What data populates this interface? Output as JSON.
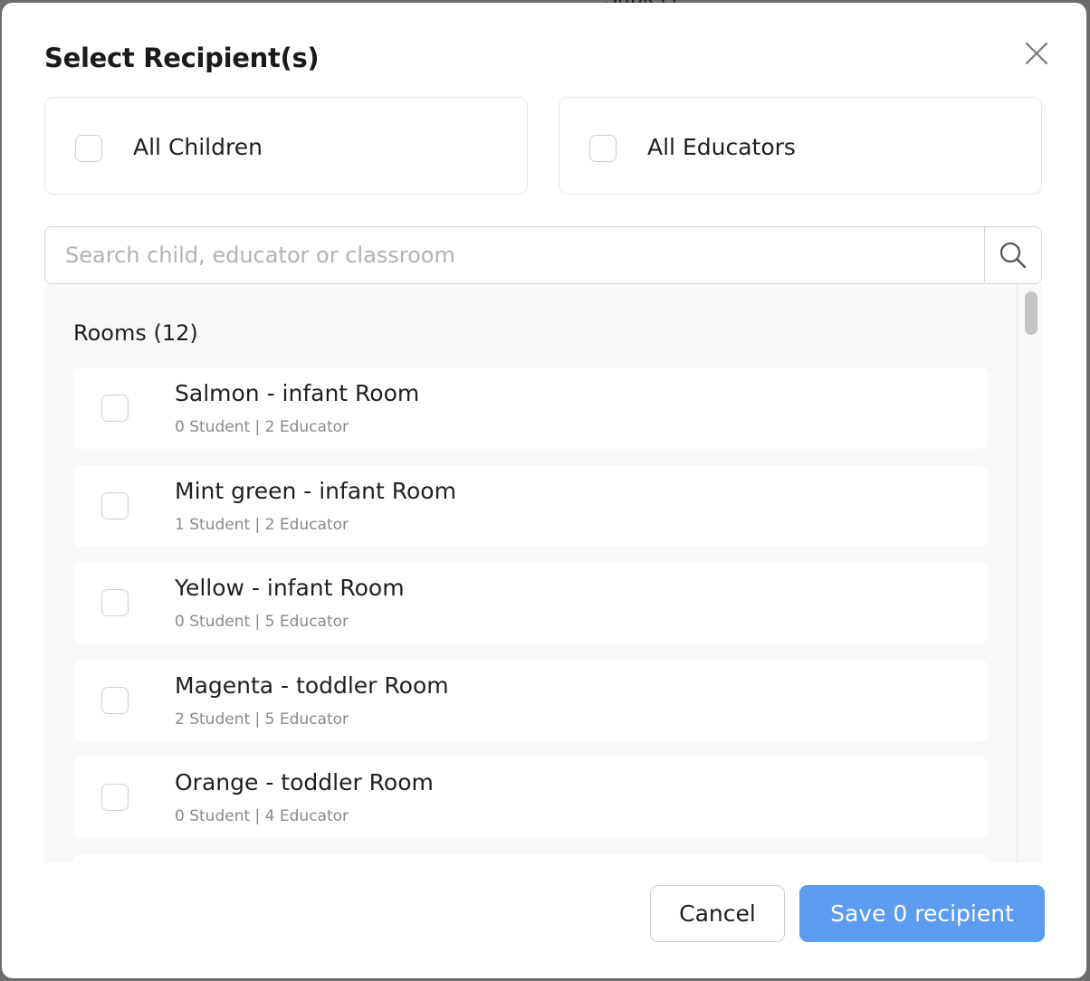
{
  "background": {
    "partial_text": "Subject"
  },
  "modal": {
    "title": "Select Recipient(s)",
    "close_icon": "close-icon"
  },
  "all_options": {
    "children_label": "All Children",
    "children_checked": false,
    "educators_label": "All Educators",
    "educators_checked": false
  },
  "search": {
    "placeholder": "Search child, educator or classroom",
    "value": "",
    "icon": "search-icon"
  },
  "rooms": {
    "header": "Rooms (12)",
    "items": [
      {
        "name": "Salmon - infant Room",
        "meta": "0 Student | 2 Educator",
        "checked": false
      },
      {
        "name": "Mint green - infant Room",
        "meta": "1 Student | 2 Educator",
        "checked": false
      },
      {
        "name": "Yellow - infant Room",
        "meta": "0 Student | 5 Educator",
        "checked": false
      },
      {
        "name": "Magenta - toddler Room",
        "meta": "2 Student | 5 Educator",
        "checked": false
      },
      {
        "name": "Orange - toddler Room",
        "meta": "0 Student | 4 Educator",
        "checked": false
      },
      {
        "name": "",
        "meta": "",
        "checked": false
      }
    ]
  },
  "footer": {
    "cancel_label": "Cancel",
    "save_label": "Save 0 recipient"
  },
  "colors": {
    "primary": "#5c9cf0",
    "list_background": "#f8f8f8",
    "border": "#e6e6e6",
    "meta_text": "#8a8a8a"
  }
}
